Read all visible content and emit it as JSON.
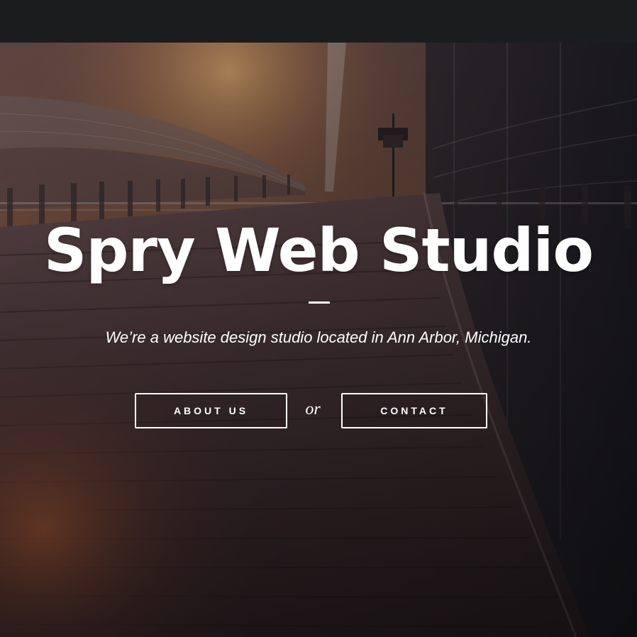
{
  "hero": {
    "title": "Spry Web Studio",
    "tagline": "We’re a website design studio located in Ann Arbor, Michigan.",
    "or_text": "or",
    "about_button_label": "ABOUT US",
    "contact_button_label": "CONTACT"
  },
  "colors": {
    "topbar": "#1b1c1e",
    "text": "#ffffff",
    "button_border": "#ffffff"
  }
}
